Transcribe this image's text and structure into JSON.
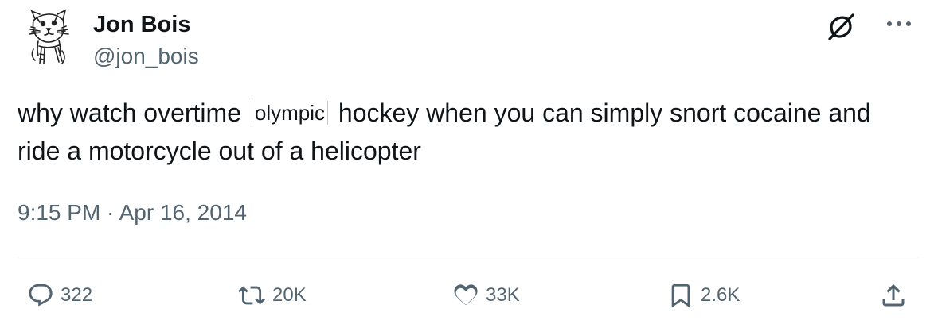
{
  "author": {
    "name": "Jon Bois",
    "handle": "@jon_bois"
  },
  "tweet": {
    "text_before": "why watch overtime",
    "inline_word": "olympic",
    "text_after": "hockey when you can simply snort cocaine and ride a motorcycle out of a helicopter",
    "timestamp": "9:15 PM · Apr 16, 2014"
  },
  "actions": {
    "replies": "322",
    "reposts": "20K",
    "likes": "33K",
    "bookmarks": "2.6K"
  },
  "icons": {
    "grok": "grok-icon",
    "more": "more-icon",
    "reply": "reply-icon",
    "repost": "repost-icon",
    "like": "heart-icon",
    "bookmark": "bookmark-icon",
    "share": "share-icon"
  },
  "colors": {
    "text_primary": "#0f1419",
    "text_secondary": "#536471",
    "divider": "#eff3f4"
  }
}
